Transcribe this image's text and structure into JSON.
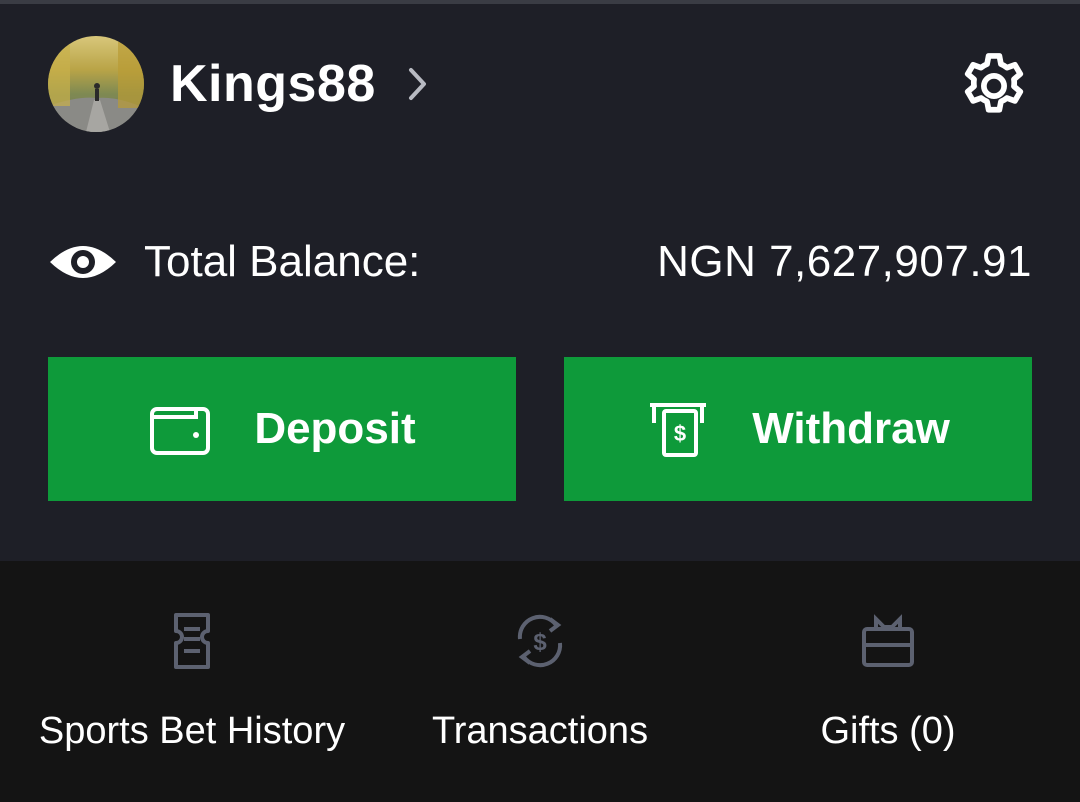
{
  "profile": {
    "username": "Kings88",
    "avatar_icon": "avatar-photo",
    "chevron_icon": "chevron-right-icon"
  },
  "header": {
    "settings_icon": "gear-icon"
  },
  "balance": {
    "visibility_icon": "eye-icon",
    "label": "Total Balance:",
    "value": "NGN 7,627,907.91"
  },
  "actions": {
    "deposit": {
      "label": "Deposit",
      "icon": "wallet-icon"
    },
    "withdraw": {
      "label": "Withdraw",
      "icon": "atm-cash-icon"
    }
  },
  "menu": {
    "items": [
      {
        "label": "Sports Bet History",
        "icon": "ticket-icon"
      },
      {
        "label": "Transactions",
        "icon": "money-exchange-icon"
      },
      {
        "label": "Gifts (0)",
        "icon": "gift-icon"
      }
    ]
  },
  "colors": {
    "background": "#1e1f27",
    "menu_background": "#141414",
    "accent_green": "#0e9a3a",
    "text": "#ffffff",
    "muted_icon": "#5c6170"
  }
}
